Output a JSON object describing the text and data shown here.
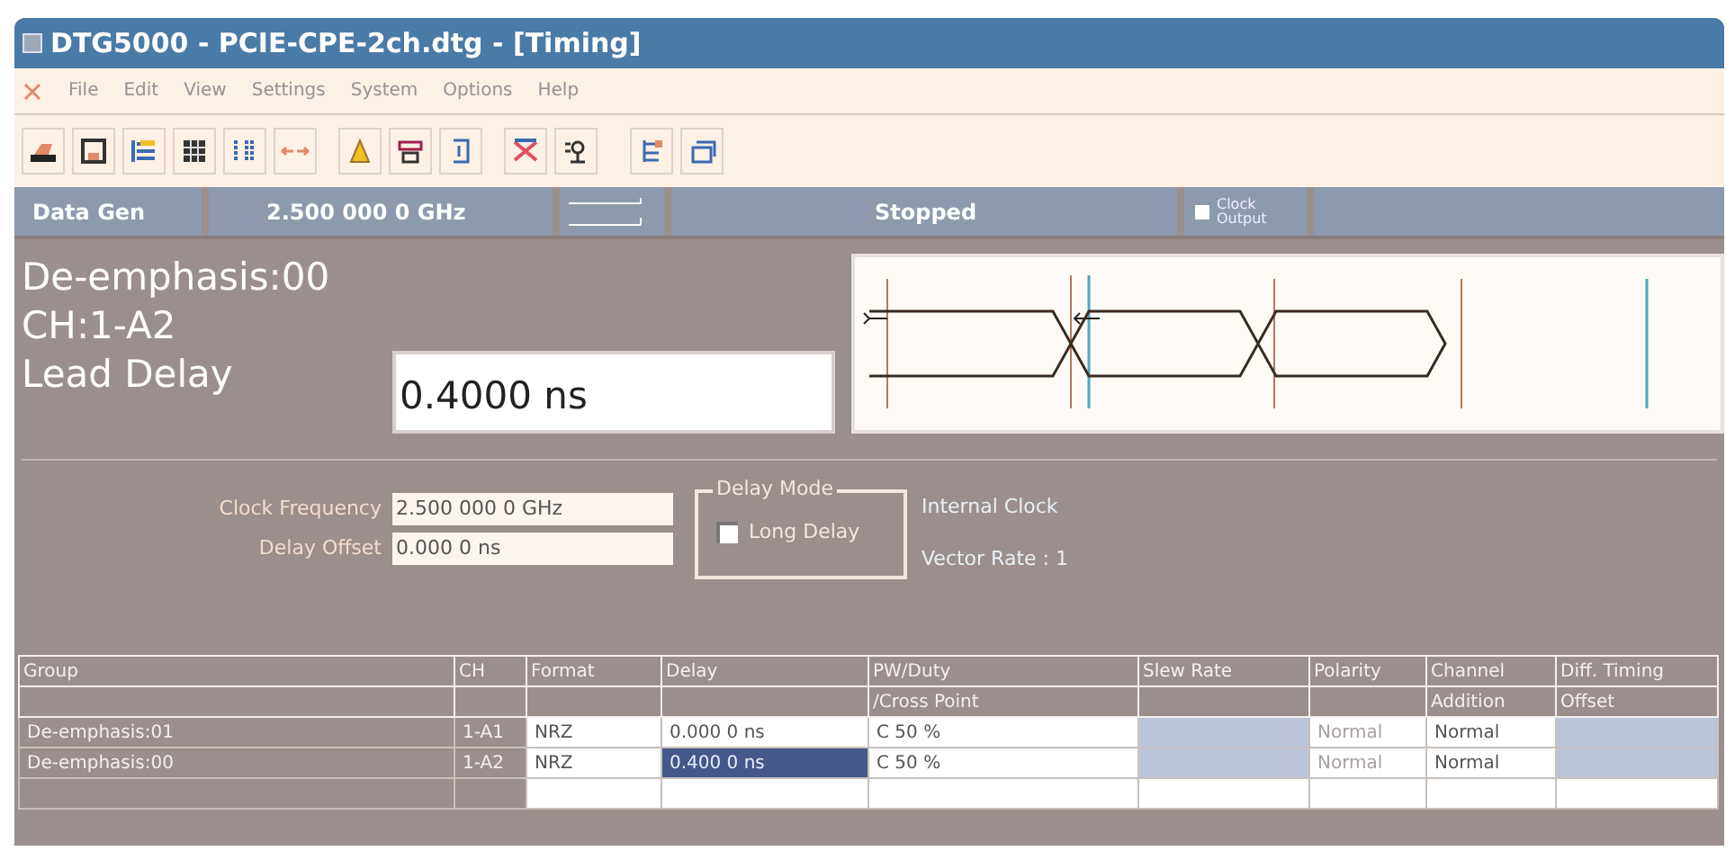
{
  "window": {
    "title": "DTG5000 - PCIE-CPE-2ch.dtg - [Timing]"
  },
  "menu": [
    "File",
    "Edit",
    "View",
    "Settings",
    "System",
    "Options",
    "Help"
  ],
  "status_bar": {
    "mode": "Data Gen",
    "frequency": "2.500 000 0 GHz",
    "state": "Stopped",
    "clock_output": {
      "label": "Clock Output",
      "checked": false
    }
  },
  "display": {
    "lines": [
      "De-emphasis:00",
      "CH:1-A2",
      "Lead Delay"
    ],
    "value": "0.4000 ns"
  },
  "settings": {
    "fields": [
      {
        "label": "Clock Frequency",
        "value": "2.500 000 0 GHz"
      },
      {
        "label": "Delay Offset",
        "value": "0.000 0 ns"
      }
    ],
    "delay_mode": {
      "title": "Delay Mode",
      "label": "Long Delay",
      "checked": false
    },
    "info": [
      "Internal Clock",
      "Vector Rate : 1"
    ]
  },
  "table": {
    "columns": [
      {
        "header": "Group",
        "kind": "label"
      },
      {
        "header": "CH",
        "kind": "label"
      },
      {
        "header": "Format",
        "kind": "edit"
      },
      {
        "header": "Delay",
        "kind": "edit"
      },
      {
        "header": "PW/Duty",
        "header_2": "/Cross Point",
        "kind": "edit"
      },
      {
        "header": "Slew Rate",
        "kind": "readonly"
      },
      {
        "header": "Polarity",
        "kind": "edit"
      },
      {
        "header": "Channel",
        "header_2": "Addition",
        "kind": "edit"
      },
      {
        "header": "Diff. Timing",
        "header_2": "Offset",
        "kind": "readonly"
      }
    ],
    "rows": [
      {
        "cells": [
          {
            "text": "De-emphasis:01",
            "selected": false,
            "disabled": false
          },
          {
            "text": "1-A1",
            "selected": false,
            "disabled": false
          },
          {
            "text": "NRZ",
            "selected": false,
            "disabled": false
          },
          {
            "text": "0.000 0 ns",
            "selected": false,
            "disabled": false
          },
          {
            "text": "C 50 %",
            "selected": false,
            "disabled": false
          },
          {
            "selected": false,
            "disabled": false
          },
          {
            "text": "Normal",
            "selected": false,
            "disabled": true
          },
          {
            "text": "Normal",
            "selected": false,
            "disabled": false
          },
          {
            "selected": false,
            "disabled": false
          }
        ]
      },
      {
        "cells": [
          {
            "text": "De-emphasis:00",
            "selected": false,
            "disabled": false
          },
          {
            "text": "1-A2",
            "selected": false,
            "disabled": false
          },
          {
            "text": "NRZ",
            "selected": false,
            "disabled": false
          },
          {
            "text": "0.400 0 ns",
            "selected": true,
            "disabled": false
          },
          {
            "text": "C 50 %",
            "selected": false,
            "disabled": false
          },
          {
            "selected": false,
            "disabled": false
          },
          {
            "text": "Normal",
            "selected": false,
            "disabled": true
          },
          {
            "text": "Normal",
            "selected": false,
            "disabled": false
          },
          {
            "selected": false,
            "disabled": false
          }
        ]
      }
    ]
  }
}
